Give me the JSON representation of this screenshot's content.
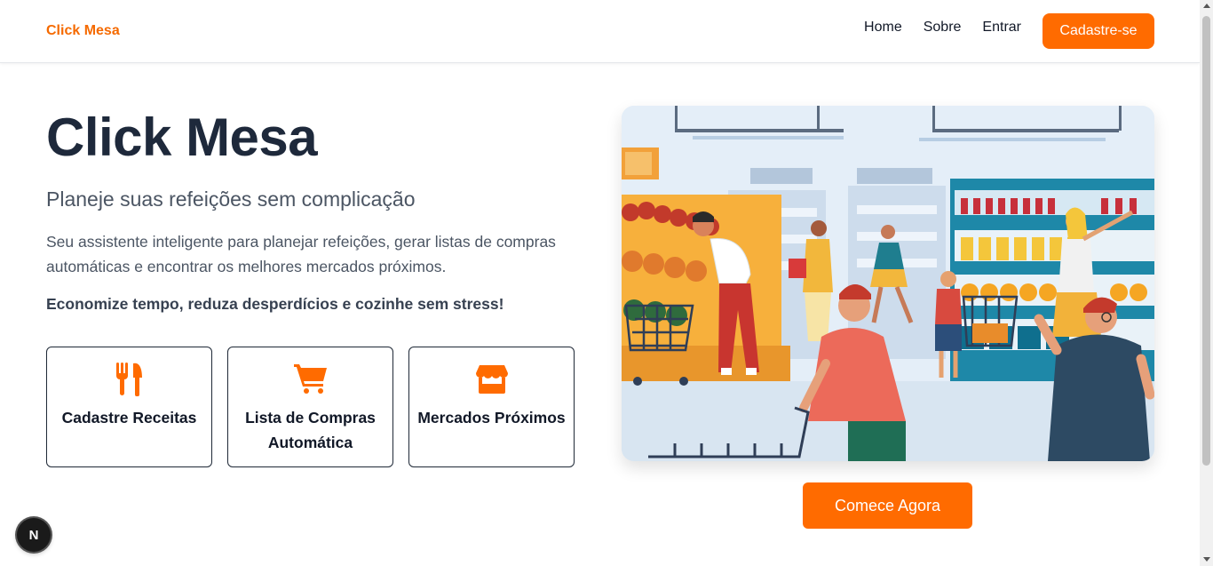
{
  "header": {
    "logo": "Click Mesa",
    "nav": [
      {
        "label": "Home"
      },
      {
        "label": "Sobre"
      },
      {
        "label": "Entrar"
      }
    ],
    "signup_label": "Cadastre-se"
  },
  "hero": {
    "title": "Click Mesa",
    "subtitle": "Planeje suas refeições sem complicação",
    "description": "Seu assistente inteligente para planejar refeições, gerar listas de compras automáticas e encontrar os melhores mercados próximos.",
    "highlight": "Economize tempo, reduza desperdícios e cozinhe sem stress!",
    "cards": [
      {
        "icon": "utensils-icon",
        "label": "Cadastre Receitas"
      },
      {
        "icon": "shopping-cart-icon",
        "label": "Lista de Compras Automática"
      },
      {
        "icon": "store-icon",
        "label": "Mercados Próximos"
      }
    ],
    "cta_label": "Comece Agora"
  },
  "floating_badge": "N",
  "colors": {
    "accent": "#ff6b00",
    "title": "#1e293b",
    "text": "#4b5563"
  }
}
